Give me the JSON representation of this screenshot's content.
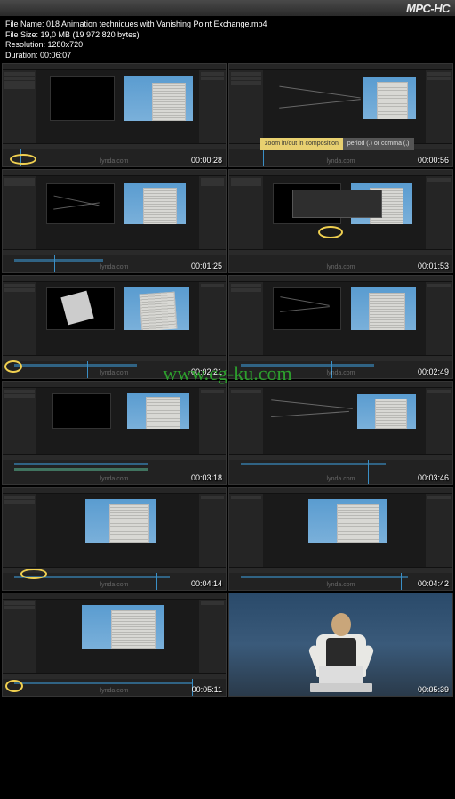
{
  "player": {
    "logo": "MPC-HC"
  },
  "fileinfo": {
    "name_label": "File Name:",
    "name_value": "018 Animation techniques with Vanishing Point Exchange.mp4",
    "size_label": "File Size:",
    "size_value": "19,0 MB (19 972 820 bytes)",
    "res_label": "Resolution:",
    "res_value": "1280x720",
    "dur_label": "Duration:",
    "dur_value": "00:06:07"
  },
  "tooltip": {
    "zoom": "zoom in/out in composition",
    "keys": "period (.) or comma (,)"
  },
  "timestamps": {
    "t0": "00:00:28",
    "t1": "00:00:56",
    "t2": "00:01:25",
    "t3": "00:01:53",
    "t4": "00:02:21",
    "t5": "00:02:49",
    "t6": "00:03:18",
    "t7": "00:03:46",
    "t8": "00:04:14",
    "t9": "00:04:42",
    "t10": "00:05:11",
    "t11": "00:05:39"
  },
  "watermark": "www.cg-ku.com",
  "lynda": "lynda.com"
}
